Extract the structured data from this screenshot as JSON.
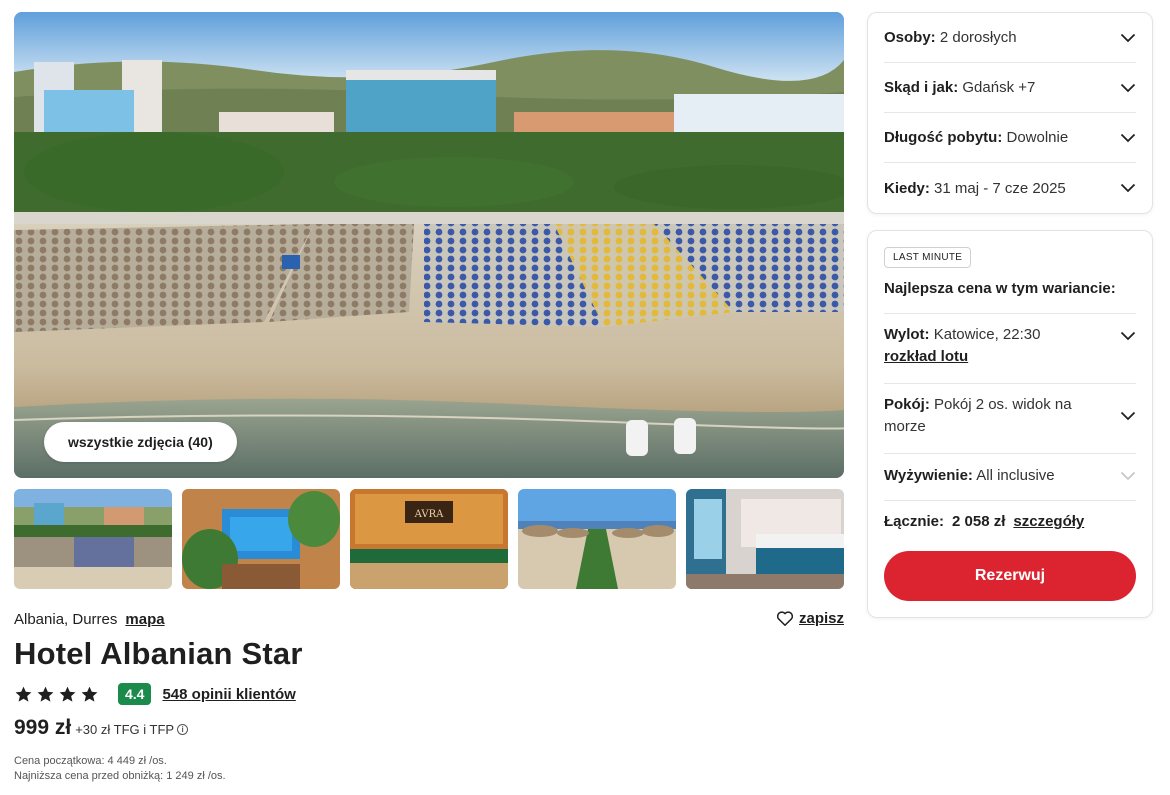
{
  "gallery": {
    "all_photos_label": "wszystkie zdjęcia (40)"
  },
  "hotel": {
    "location": "Albania, Durres",
    "map_label": "mapa",
    "save_label": "zapisz",
    "name": "Hotel Albanian Star",
    "stars": 4,
    "score": "4.4",
    "reviews_label": "548 opinii klientów",
    "price": "999 zł",
    "price_extra": "+30 zł TFG i TFP",
    "price_start_note": "Cena początkowa: 4 449 zł /os.",
    "price_lowest_note": "Najniższa cena przed obniżką: 1 249 zł /os."
  },
  "filters": {
    "people_label": "Osoby:",
    "people_value": "2 dorosłych",
    "from_label": "Skąd i jak:",
    "from_value": "Gdańsk +7",
    "duration_label": "Długość pobytu:",
    "duration_value": "Dowolnie",
    "when_label": "Kiedy:",
    "when_value": "31 maj - 7 cze 2025"
  },
  "offer": {
    "badge": "LAST MINUTE",
    "best_price_label": "Najlepsza cena w tym wariancie:",
    "departure_label": "Wylot:",
    "departure_value": "Katowice, 22:30",
    "flight_schedule_link": "rozkład lotu",
    "room_label": "Pokój:",
    "room_value": "Pokój 2 os. widok na morze",
    "board_label": "Wyżywienie:",
    "board_value": "All inclusive",
    "total_label": "Łącznie:",
    "total_value": "2 058 zł",
    "details_link": "szczegóły",
    "book_label": "Rezerwuj"
  },
  "colors": {
    "brand_red": "#dc2430",
    "score_green": "#1a8b4a"
  }
}
